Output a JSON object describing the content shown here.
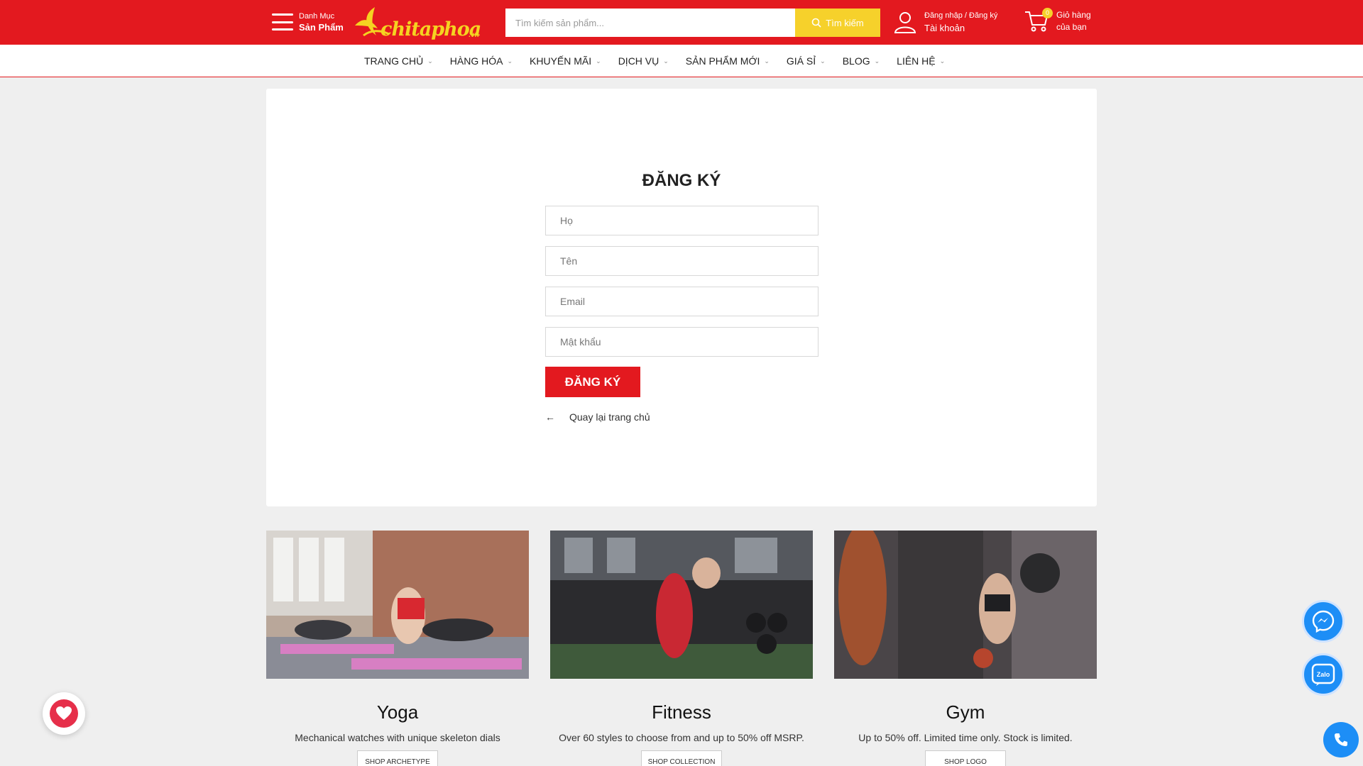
{
  "header": {
    "menu": {
      "line1": "Danh Mục",
      "line2": "Sản Phẩm"
    },
    "logo": {
      "text": "chitaphoa",
      "suffix": ".vn"
    },
    "search": {
      "placeholder": "Tìm kiếm sản phẩm...",
      "button": "Tìm kiếm"
    },
    "account": {
      "login": "Đăng nhập",
      "separator": " / ",
      "register": "Đăng ký",
      "label": "Tài khoản"
    },
    "cart": {
      "count": "0",
      "line1": "Giỏ hàng",
      "line2": "của bạn"
    }
  },
  "nav": [
    {
      "label": "Trang chủ"
    },
    {
      "label": "Hàng hóa"
    },
    {
      "label": "Khuyến mãi"
    },
    {
      "label": "Dịch vụ"
    },
    {
      "label": "Sản phẩm mới"
    },
    {
      "label": "Giá sỉ"
    },
    {
      "label": "Blog"
    },
    {
      "label": "Liên hệ"
    }
  ],
  "register": {
    "title": "ĐĂNG KÝ",
    "fields": {
      "last_name": "Họ",
      "first_name": "Tên",
      "email": "Email",
      "password": "Mật khẩu"
    },
    "submit": "ĐĂNG KÝ",
    "back": "Quay lại trang chủ"
  },
  "categories": [
    {
      "title": "Yoga",
      "desc": "Mechanical watches with unique skeleton dials",
      "button": "SHOP ARCHETYPE"
    },
    {
      "title": "Fitness",
      "desc": "Over 60 styles to choose from and up to 50% off MSRP.",
      "button": "SHOP COLLECTION"
    },
    {
      "title": "Gym",
      "desc": "Up to 50% off. Limited time only. Stock is limited.",
      "button": "SHOP LOGO"
    }
  ],
  "floating": {
    "zalo": "Zalo"
  },
  "colors": {
    "brand_red": "#e3191f",
    "accent_yellow": "#f6d12b",
    "fab_blue": "#1d8ef6",
    "fav_pink": "#e62f4a"
  }
}
